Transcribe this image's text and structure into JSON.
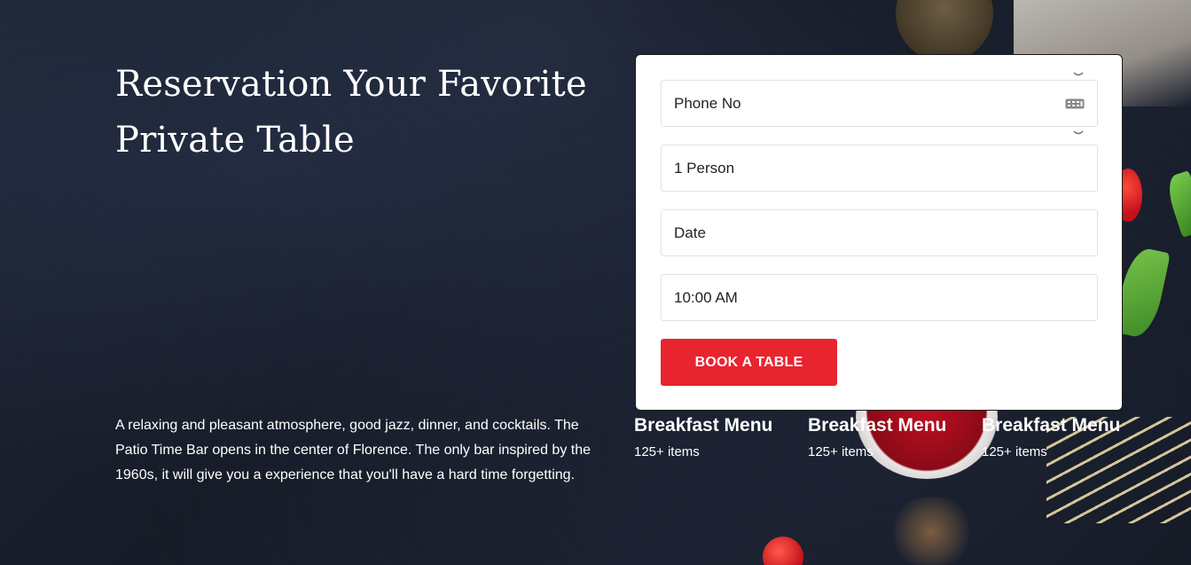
{
  "hero": {
    "title_line1": "Reservation Your Favorite",
    "title_line2": "Private Table",
    "description": "A relaxing and pleasant atmosphere, good jazz, dinner, and cocktails. The Patio Time Bar opens in the center of Florence. The only bar inspired by the 1960s, it will give you a experience that you'll have a hard time forgetting."
  },
  "reservation": {
    "phone_placeholder": "Phone No",
    "persons_value": "1 Person",
    "date_placeholder": "Date",
    "time_value": "10:00 AM",
    "submit_label": "BOOK A TABLE"
  },
  "menu_stats": [
    {
      "title": "Breakfast Menu",
      "count": "125+ items"
    },
    {
      "title": "Breakfast Menu",
      "count": "125+ items"
    },
    {
      "title": "Breakfast Menu",
      "count": "125+ items"
    }
  ],
  "icons": {
    "keyboard": "keyboard-icon",
    "chevron": "chevron-down-icon"
  },
  "colors": {
    "accent": "#e8242f",
    "background": "#1a2030",
    "card": "#ffffff",
    "text_light": "#ffffff"
  }
}
